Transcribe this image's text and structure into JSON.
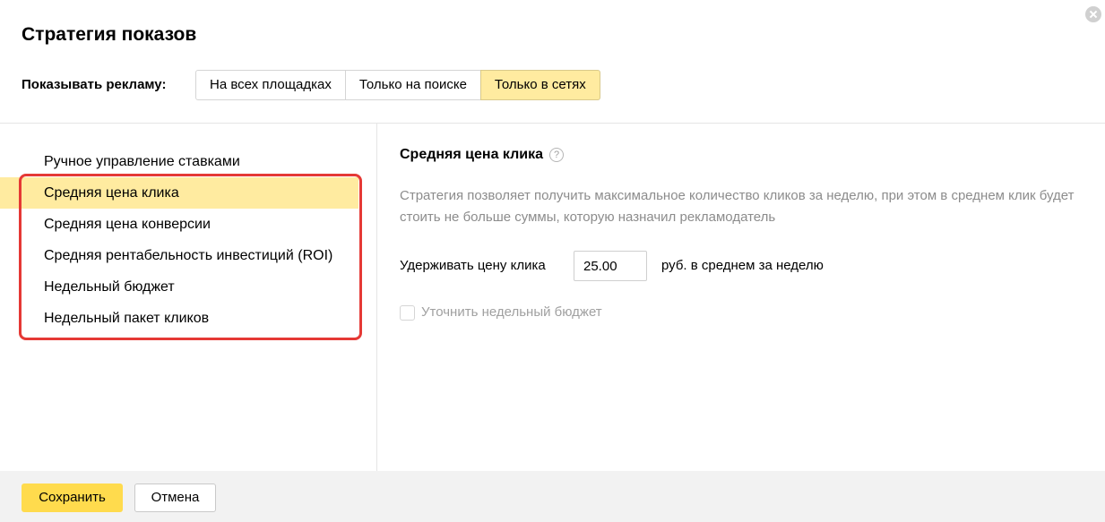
{
  "dialog": {
    "title": "Стратегия показов",
    "close_icon": "close-icon"
  },
  "show_ads": {
    "label": "Показывать рекламу:",
    "options": [
      {
        "label": "На всех площадках",
        "active": false
      },
      {
        "label": "Только на поиске",
        "active": false
      },
      {
        "label": "Только в сетях",
        "active": true
      }
    ]
  },
  "strategies": {
    "items": [
      {
        "label": "Ручное управление ставками",
        "selected": false
      },
      {
        "label": "Средняя цена клика",
        "selected": true
      },
      {
        "label": "Средняя цена конверсии",
        "selected": false
      },
      {
        "label": "Средняя рентабельность инвестиций (ROI)",
        "selected": false
      },
      {
        "label": "Недельный бюджет",
        "selected": false
      },
      {
        "label": "Недельный пакет кликов",
        "selected": false
      }
    ],
    "highlight_color": "#e53935",
    "selected_color": "#ffeba0"
  },
  "detail": {
    "title": "Средняя цена клика",
    "help_icon": "?",
    "description": "Стратегия позволяет получить максимальное количество кликов за неделю, при этом в среднем клик будет стоить не больше суммы, которую назначил рекламодатель",
    "hold_label": "Удерживать цену клика",
    "price_value": "25.00",
    "unit_label": "руб. в среднем за неделю",
    "budget_checkbox_label": "Уточнить недельный бюджет",
    "budget_checked": false
  },
  "footer": {
    "save_label": "Сохранить",
    "cancel_label": "Отмена",
    "save_color": "#ffdb4d"
  }
}
